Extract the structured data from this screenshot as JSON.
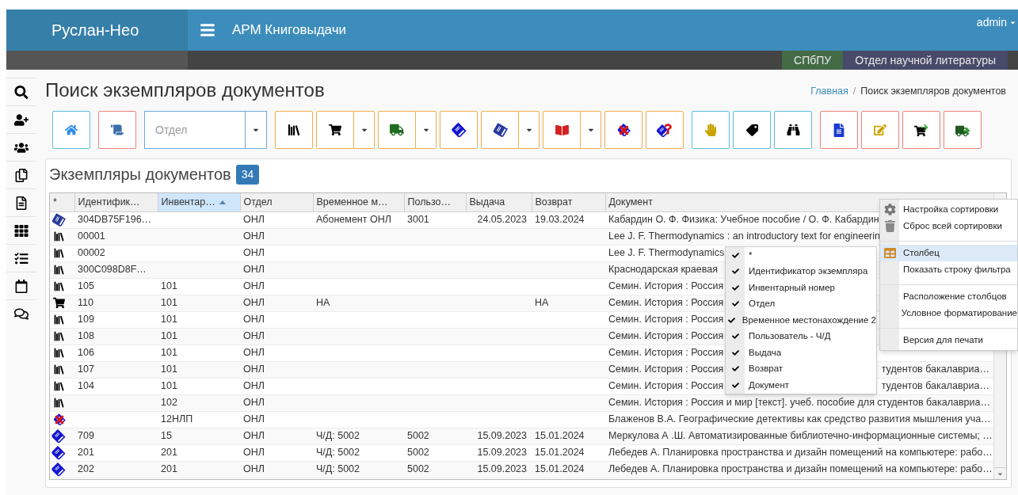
{
  "app": {
    "brand": "Руслан-Нео",
    "module_title": "АРМ Книговыдачи",
    "user": "admin"
  },
  "org_bar": {
    "organization": "СПбПУ",
    "department": "Отдел научной литературы"
  },
  "page": {
    "title": "Поиск экземпляров документов",
    "breadcrumb_separator": "/",
    "breadcrumb": [
      {
        "label": "Главная",
        "link": true
      },
      {
        "label": "Поиск экземпляров документов",
        "link": false
      }
    ]
  },
  "sidebar": {
    "items": [
      {
        "kind": "search"
      },
      {
        "kind": "user-plus"
      },
      {
        "kind": "users"
      },
      {
        "kind": "copy"
      },
      {
        "kind": "file"
      },
      {
        "kind": "grid"
      },
      {
        "kind": "checklist"
      },
      {
        "kind": "calendar"
      },
      {
        "kind": "comments"
      }
    ]
  },
  "toolbar": {
    "groups": [
      {
        "color": "#5bc0de",
        "items": [
          {
            "kind": "home",
            "split": false
          }
        ]
      },
      {
        "color": "#f0837a",
        "items": [
          {
            "kind": "scroll",
            "split": false
          }
        ]
      },
      {
        "color": "#6fa8d6",
        "items": [
          {
            "kind": "select",
            "placeholder": "Отдел",
            "split": true
          }
        ]
      },
      {
        "color": "#f0ad4e",
        "items": [
          {
            "kind": "bookshelf",
            "split": false
          },
          {
            "kind": "cart",
            "split": true
          },
          {
            "kind": "truck",
            "split": true
          },
          {
            "kind": "book",
            "split": false
          },
          {
            "kind": "books",
            "split": true
          },
          {
            "kind": "open-book",
            "split": true
          },
          {
            "kind": "crossed-book",
            "split": false
          },
          {
            "kind": "book-question",
            "split": false
          }
        ]
      },
      {
        "color": "#5bc0de",
        "items": [
          {
            "kind": "hand-document",
            "split": false
          },
          {
            "kind": "tag",
            "split": false
          },
          {
            "kind": "binoculars",
            "split": false
          }
        ]
      },
      {
        "color": "#f0837a",
        "items": [
          {
            "kind": "document-list",
            "split": false
          },
          {
            "kind": "hand-pen",
            "split": false
          },
          {
            "kind": "cart-arrow",
            "split": false
          },
          {
            "kind": "truck-arrow",
            "split": false
          }
        ]
      }
    ]
  },
  "grid": {
    "title": "Экземпляры документов",
    "count": "34",
    "columns": [
      {
        "label": "*",
        "sorted": false
      },
      {
        "label": "Идентифик…",
        "sorted": false
      },
      {
        "label": "Инвентар…",
        "sorted": true
      },
      {
        "label": "Отдел",
        "sorted": false
      },
      {
        "label": "Временное м…",
        "sorted": false
      },
      {
        "label": "Пользо…",
        "sorted": false
      },
      {
        "label": "Выдача",
        "sorted": false
      },
      {
        "label": "Возврат",
        "sorted": false
      },
      {
        "label": "Документ",
        "sorted": false
      }
    ],
    "rows": [
      {
        "kind": "books",
        "id": "304DB75F196…",
        "dept": "ОНЛ",
        "location": "Абонемент ОНЛ",
        "user": "3001",
        "issue": "24.05.2023",
        "return": "19.03.2024",
        "document": "Кабардин О. Ф. Физика: Учебное пособие / О. Ф. Кабардин"
      },
      {
        "kind": "bookshelf",
        "id": "00001",
        "dept": "ОНЛ",
        "document": "Lee J. F. Thermodynamics : an introductory text for engineerin"
      },
      {
        "kind": "bookshelf",
        "id": "00002",
        "dept": "ОНЛ",
        "document": "Lee J. F. Thermodynamics"
      },
      {
        "kind": "bookshelf",
        "id": "300C098D8F…",
        "dept": "ОНЛ",
        "document": "Краснодарская краевая"
      },
      {
        "kind": "bookshelf",
        "id": "105",
        "inventory": "101",
        "dept": "ОНЛ",
        "document": "Семин. История : Россия"
      },
      {
        "kind": "cart",
        "id": "110",
        "inventory": "101",
        "dept": "ОНЛ",
        "location": "НА",
        "return": "НА",
        "document": "Семин. История : Россия"
      },
      {
        "kind": "bookshelf",
        "id": "109",
        "inventory": "101",
        "dept": "ОНЛ",
        "document": "Семин. История : Россия"
      },
      {
        "kind": "bookshelf",
        "id": "108",
        "inventory": "101",
        "dept": "ОНЛ",
        "document": "Семин. История : Россия"
      },
      {
        "kind": "bookshelf",
        "id": "106",
        "inventory": "101",
        "dept": "ОНЛ",
        "document": "Семин. История : Россия"
      },
      {
        "kind": "bookshelf",
        "id": "107",
        "inventory": "101",
        "dept": "ОНЛ",
        "document": "Семин. История : Россия",
        "document_tail": "тудентов бакалавриа…"
      },
      {
        "kind": "bookshelf",
        "id": "104",
        "inventory": "101",
        "dept": "ОНЛ",
        "document": "Семин. История : Россия",
        "document_tail": "тудентов бакалавриа…"
      },
      {
        "kind": "bookshelf",
        "inventory": "102",
        "dept": "ОНЛ",
        "document": "Семин. История : Россия и мир [текст]. учеб. пособие для студентов бакалавриа…"
      },
      {
        "kind": "crossed-book",
        "inventory": "12НЛП",
        "dept": "ОНЛ",
        "document": "Блаженов В.А. Географические детективы как средство развития мышления уча…"
      },
      {
        "kind": "book",
        "id": "709",
        "inventory": "15",
        "dept": "ОНЛ",
        "location": "Ч/Д: 5002",
        "user": "5002",
        "issue": "15.09.2023",
        "return": "15.01.2024",
        "document": "Меркулова А .Ш. Автоматизированные библиотечно-информационные системы; …"
      },
      {
        "kind": "book",
        "id": "201",
        "inventory": "201",
        "dept": "ОНЛ",
        "location": "Ч/Д: 5002",
        "user": "5002",
        "issue": "15.09.2023",
        "return": "15.01.2024",
        "document": "Лебедев А. Планировка пространства и дизайн помещений на компьютере: рабо…"
      },
      {
        "kind": "book",
        "id": "202",
        "inventory": "201",
        "dept": "ОНЛ",
        "location": "Ч/Д: 5002",
        "user": "5002",
        "issue": "15.09.2023",
        "return": "15.01.2024",
        "document": "Лебедев А. Планировка пространства и дизайн помещений на компьютере: рабо…"
      }
    ]
  },
  "context_menu": {
    "groups": [
      [
        {
          "label": "Настройка сортировки",
          "kind": "gear",
          "selected": false
        },
        {
          "label": "Сброс всей сортировки",
          "kind": "trash",
          "selected": false
        }
      ],
      [
        {
          "label": "Столбец",
          "kind": "columns",
          "selected": true
        },
        {
          "label": "Показать строку фильтра",
          "kind": "plain",
          "selected": false
        }
      ],
      [
        {
          "label": "Расположение столбцов",
          "kind": "plain",
          "selected": false
        },
        {
          "label": "Условное форматирование",
          "kind": "plain",
          "selected": false
        }
      ],
      [
        {
          "label": "Версия для печати",
          "kind": "plain",
          "selected": false
        }
      ]
    ]
  },
  "column_menu": {
    "items": [
      {
        "label": "*",
        "checked": true
      },
      {
        "label": "Идентификатор экземпляра",
        "checked": true
      },
      {
        "label": "Инвентарный номер",
        "checked": true
      },
      {
        "label": "Отдел",
        "checked": true
      },
      {
        "label": "Временное местонахождение 2",
        "checked": true
      },
      {
        "label": "Пользователь - Ч/Д",
        "checked": true
      },
      {
        "label": "Выдача",
        "checked": true
      },
      {
        "label": "Возврат",
        "checked": true
      },
      {
        "label": "Документ",
        "checked": true
      }
    ]
  }
}
